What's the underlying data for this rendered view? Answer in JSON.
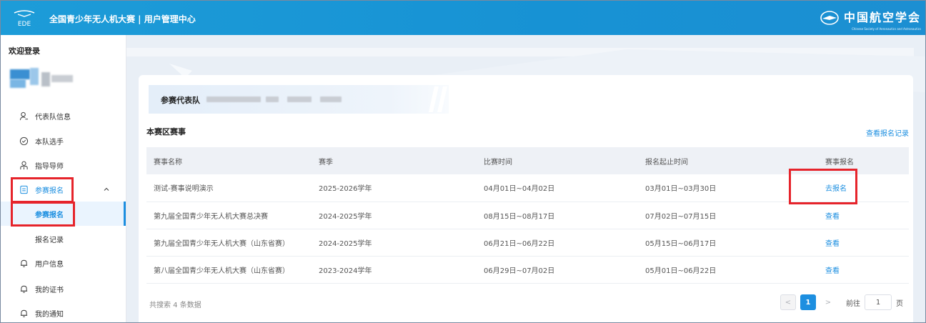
{
  "header": {
    "logo_text": "EDE",
    "app_title": "全国青少年无人机大赛 | 用户管理中心",
    "org_name": "中国航空学会",
    "org_sub": "Chinese Society of Aeronautics and Astronautics"
  },
  "sidebar": {
    "welcome": "欢迎登录",
    "items": [
      {
        "label": "代表队信息",
        "icon": "user-icon"
      },
      {
        "label": "本队选手",
        "icon": "check-circle-icon"
      },
      {
        "label": "指导导师",
        "icon": "users-icon"
      },
      {
        "label": "参赛报名",
        "icon": "document-icon"
      },
      {
        "label": "用户信息",
        "icon": "bell-icon"
      },
      {
        "label": "我的证书",
        "icon": "bell-icon"
      },
      {
        "label": "我的通知",
        "icon": "bell-icon"
      }
    ],
    "submenu": [
      {
        "label": "参赛报名"
      },
      {
        "label": "报名记录"
      }
    ]
  },
  "main": {
    "team_label": "参赛代表队",
    "section_title": "本赛区赛事",
    "records_link": "查看报名记录",
    "table": {
      "headers": [
        "赛事名称",
        "赛季",
        "比赛时间",
        "报名起止时间",
        "赛事报名"
      ],
      "rows": [
        [
          "测试-赛事说明演示",
          "2025-2026学年",
          "04月01日~04月02日",
          "03月01日~03月30日",
          "去报名"
        ],
        [
          "第九届全国青少年无人机大赛总决赛",
          "2024-2025学年",
          "08月15日~08月17日",
          "07月02日~07月15日",
          "查看"
        ],
        [
          "第九届全国青少年无人机大赛（山东省赛）",
          "2024-2025学年",
          "06月21日~06月22日",
          "05月15日~06月17日",
          "查看"
        ],
        [
          "第八届全国青少年无人机大赛（山东省赛）",
          "2023-2024学年",
          "06月29日~07月02日",
          "05月01日~06月22日",
          "查看"
        ]
      ]
    },
    "footer_count": "共搜索 4 条数据",
    "pagination": {
      "prev": "<",
      "current": "1",
      "next": ">",
      "goto_label": "前往",
      "goto_value": "1",
      "page_suffix": "页"
    }
  },
  "colors": {
    "brand": "#1792d4",
    "accent": "#1d8fe0",
    "highlight": "#e6242b"
  }
}
